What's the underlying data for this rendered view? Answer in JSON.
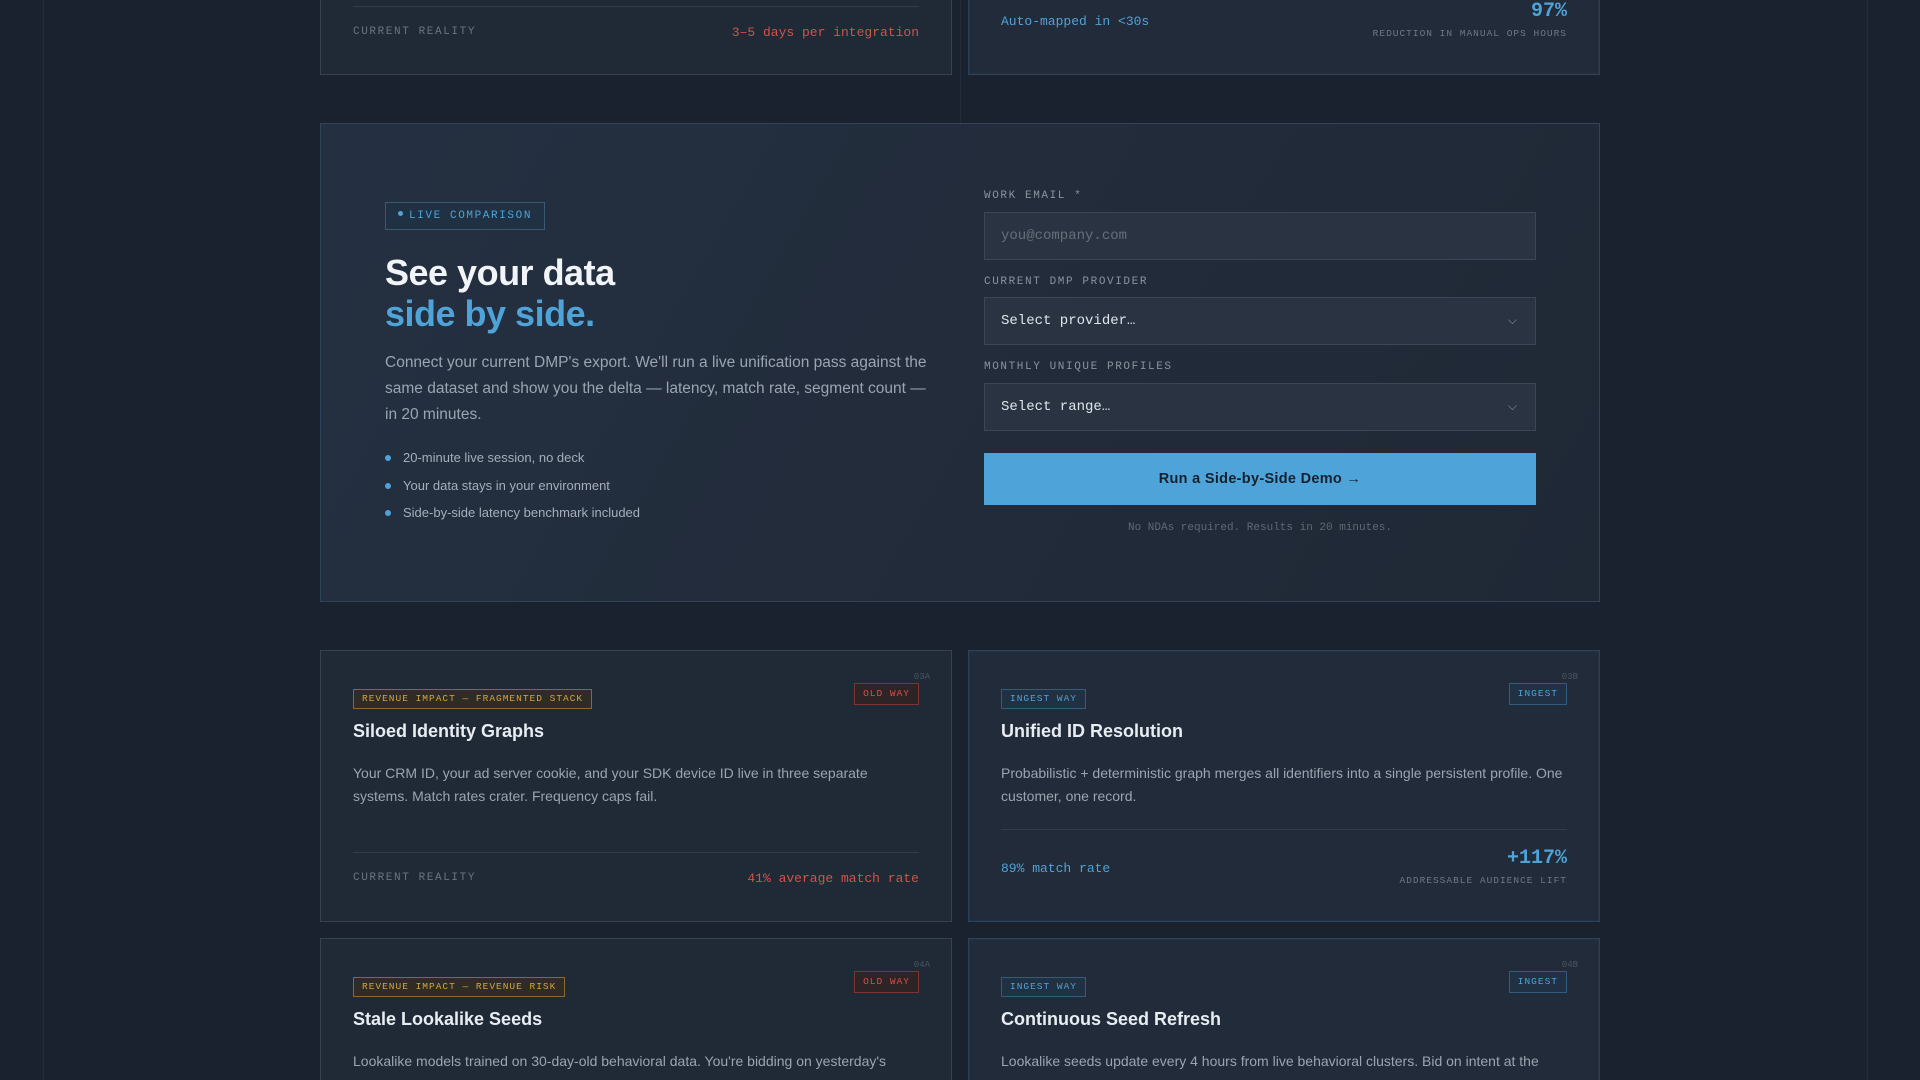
{
  "top_old_card": {
    "reality_label": "CURRENT REALITY",
    "reality_value": "3–5 days per integration"
  },
  "top_new_card": {
    "value": "Auto-mapped in <30s",
    "stat": "97%",
    "stat_caption": "REDUCTION IN MANUAL OPS HOURS"
  },
  "demo": {
    "badge": "LIVE COMPARISON",
    "title_line1": "See your data",
    "title_line2": "side by side.",
    "description": "Connect your current DMP's export. We'll run a live unification pass against the same dataset and show you the delta — latency, match rate, segment count — in 20 minutes.",
    "bullets": [
      "20-minute live session, no deck",
      "Your data stays in your environment",
      "Side-by-side latency benchmark included"
    ],
    "form": {
      "email_label": "WORK EMAIL *",
      "email_placeholder": "you@company.com",
      "provider_label": "CURRENT DMP PROVIDER",
      "provider_value": "Select provider…",
      "profiles_label": "MONTHLY UNIQUE PROFILES",
      "profiles_value": "Select range…",
      "cta_label": "Run a Side-by-Side Demo →",
      "note": "No NDAs required. Results in 20 minutes."
    }
  },
  "features": [
    {
      "tag": "REVENUE IMPACT — FRAGMENTED STACK",
      "badge": "OLD WAY",
      "num": "03A",
      "title": "Siloed Identity Graphs",
      "description": "Your CRM ID, your ad server cookie, and your SDK device ID live in three separate systems. Match rates crater. Frequency caps fail.",
      "reality_label": "CURRENT REALITY",
      "reality_value": "41% average match rate"
    },
    {
      "tag": "INGEST WAY",
      "badge": "INGEST",
      "num": "03B",
      "title": "Unified ID Resolution",
      "description": "Probabilistic + deterministic graph merges all identifiers into a single persistent profile. One customer, one record.",
      "value": "89% match rate",
      "stat": "+117%",
      "stat_caption": "ADDRESSABLE AUDIENCE LIFT"
    },
    {
      "tag": "REVENUE IMPACT — REVENUE RISK",
      "badge": "OLD WAY",
      "num": "04A",
      "title": "Stale Lookalike Seeds",
      "description": "Lookalike models trained on 30-day-old behavioral data. You're bidding on yesterday's"
    },
    {
      "tag": "INGEST WAY",
      "badge": "INGEST",
      "num": "04B",
      "title": "Continuous Seed Refresh",
      "description": "Lookalike seeds update every 4 hours from live behavioral clusters. Bid on intent at the"
    }
  ]
}
